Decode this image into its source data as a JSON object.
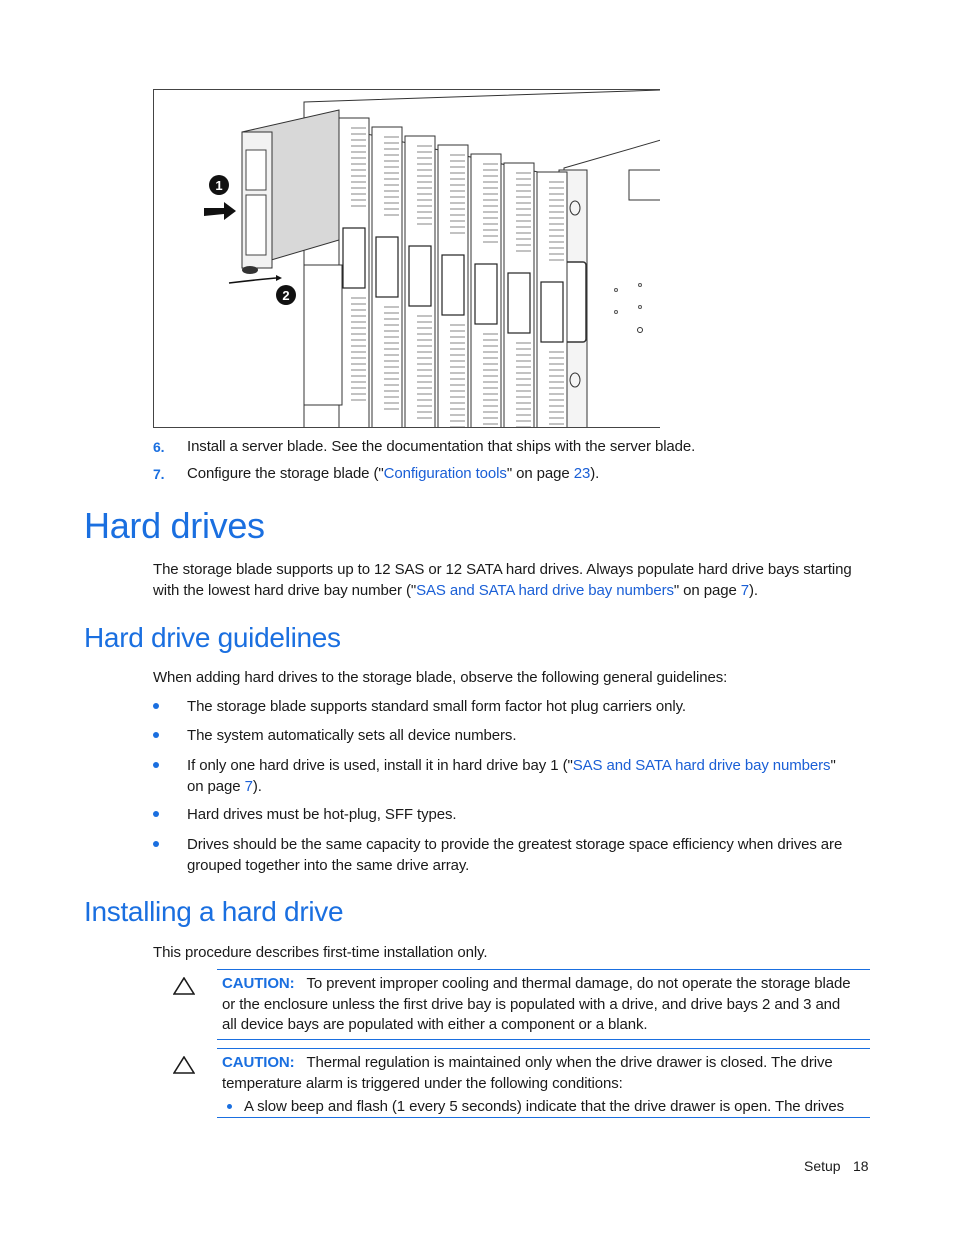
{
  "figure": {
    "description": "Storage blade installation illustration",
    "callouts": [
      "1",
      "2"
    ]
  },
  "steps": [
    {
      "number": "6.",
      "text": "Install a server blade. See the documentation that ships with the server blade."
    },
    {
      "number": "7.",
      "text_before": "Configure the storage blade (\"",
      "link": "Configuration tools",
      "text_middle": "\" on page ",
      "page_link": "23",
      "text_after": ")."
    }
  ],
  "section_hard_drives": {
    "title": "Hard drives",
    "para_line1": "The storage blade supports up to 12 SAS or 12 SATA hard drives. Always populate hard drive bays starting",
    "para_line2_before": "with the lowest hard drive bay number (\"",
    "para_link": "SAS and SATA hard drive bay numbers",
    "para_middle": "\" on page ",
    "para_page": "7",
    "para_after": ")."
  },
  "section_guidelines": {
    "title": "Hard drive guidelines",
    "intro": "When adding hard drives to the storage blade, observe the following general guidelines:",
    "bullets": [
      {
        "text": "The storage blade supports standard small form factor hot plug carriers only."
      },
      {
        "text": "The system automatically sets all device numbers."
      },
      {
        "text_before": "If only one hard drive is used, install it in hard drive bay 1 (\"",
        "link": "SAS and SATA hard drive bay numbers",
        "text_line2_before": "on page ",
        "page": "7",
        "text_after": ")."
      },
      {
        "text": "Hard drives must be hot-plug, SFF types."
      },
      {
        "line1": "Drives should be the same capacity to provide the greatest storage space efficiency when drives are",
        "line2": "grouped together into the same drive array."
      }
    ]
  },
  "section_installing": {
    "title": "Installing a hard drive",
    "intro": "This procedure describes first-time installation only.",
    "cautions": [
      {
        "label": "CAUTION:",
        "line1": "To prevent improper cooling and thermal damage, do not operate the storage blade",
        "line2": "or the enclosure unless the first drive bay is populated with a drive, and drive bays 2 and 3 and",
        "line3": "all device bays are populated with either a component or a blank."
      },
      {
        "label": "CAUTION:",
        "line1": "Thermal regulation is maintained only when the drive drawer is closed. The drive",
        "line2": "temperature alarm is triggered under the following conditions:",
        "bullet": "A slow beep and flash (1 every 5 seconds) indicate that the drive drawer is open. The drives"
      }
    ]
  },
  "footer": {
    "section": "Setup",
    "page": "18"
  },
  "colors": {
    "heading": "#1a6fe0",
    "link": "#1a5fd6",
    "text": "#1a1a1a"
  }
}
